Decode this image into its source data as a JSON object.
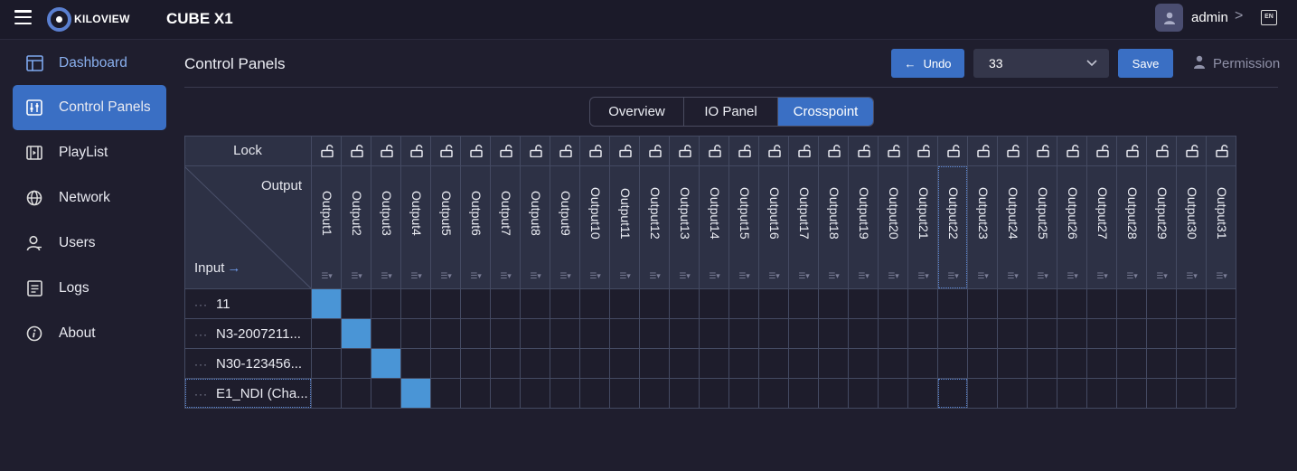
{
  "topbar": {
    "brand": "KILOVIEW",
    "app_title": "CUBE X1",
    "user": "admin",
    "user_chevron": ">",
    "lang": "EN"
  },
  "sidebar": {
    "items": [
      {
        "label": "Dashboard",
        "icon": "dashboard-icon"
      },
      {
        "label": "Control Panels",
        "icon": "sliders-icon"
      },
      {
        "label": "PlayList",
        "icon": "film-icon"
      },
      {
        "label": "Network",
        "icon": "globe-icon"
      },
      {
        "label": "Users",
        "icon": "user-icon"
      },
      {
        "label": "Logs",
        "icon": "document-icon"
      },
      {
        "label": "About",
        "icon": "info-icon"
      }
    ]
  },
  "main": {
    "title": "Control Panels",
    "undo_label": "Undo",
    "select_value": "33",
    "save_label": "Save",
    "permission_label": "Permission",
    "tabs": [
      {
        "label": "Overview"
      },
      {
        "label": "IO Panel"
      },
      {
        "label": "Crosspoint"
      }
    ]
  },
  "grid": {
    "lock_label": "Lock",
    "output_label": "Output",
    "input_label": "Input",
    "input_arrow": "→",
    "columns": [
      "Output1",
      "Output2",
      "Output3",
      "Output4",
      "Output5",
      "Output6",
      "Output7",
      "Output8",
      "Output9",
      "Output10",
      "Output11",
      "Output12",
      "Output13",
      "Output14",
      "Output15",
      "Output16",
      "Output17",
      "Output18",
      "Output19",
      "Output20",
      "Output21",
      "Output22",
      "Output23",
      "Output24",
      "Output25",
      "Output26",
      "Output27",
      "Output28",
      "Output29",
      "Output30",
      "Output31"
    ],
    "rows": [
      "11",
      "N3-2007211...",
      "N30-123456...",
      "E1_NDI (Cha..."
    ],
    "active": [
      [
        0,
        0
      ],
      [
        1,
        1
      ],
      [
        2,
        2
      ],
      [
        3,
        3
      ]
    ],
    "focused_column": 21,
    "focused_row": 3,
    "column_menu_glyph": "☰▾"
  },
  "colors": {
    "accent": "#3a6fc4",
    "active_cell": "#4a95d6",
    "background": "#1f1e2e"
  }
}
